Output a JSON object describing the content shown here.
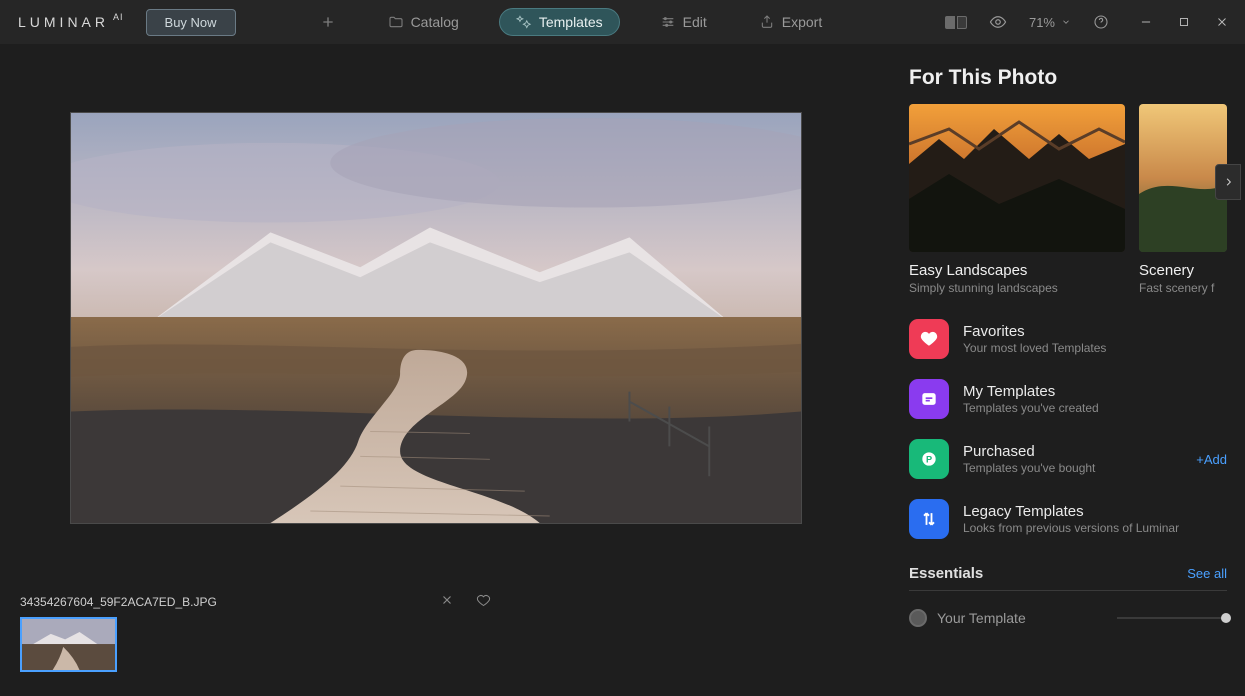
{
  "app": {
    "logo": "LUMINAR",
    "logo_sup": "AI",
    "buy": "Buy Now"
  },
  "nav": {
    "catalog": "Catalog",
    "templates": "Templates",
    "edit": "Edit",
    "export": "Export"
  },
  "toolbar": {
    "zoom": "71%"
  },
  "file": {
    "name": "34354267604_59F2ACA7ED_B.JPG"
  },
  "panel": {
    "title": "For This Photo",
    "collections": [
      {
        "name": "Easy Landscapes",
        "desc": "Simply stunning landscapes"
      },
      {
        "name": "Scenery",
        "desc": "Fast scenery f"
      }
    ],
    "categories": [
      {
        "title": "Favorites",
        "desc": "Your most loved Templates",
        "color": "#ef3b56",
        "icon": "heart"
      },
      {
        "title": "My Templates",
        "desc": "Templates you've created",
        "color": "#8a3bef",
        "icon": "card"
      },
      {
        "title": "Purchased",
        "desc": "Templates you've bought",
        "color": "#18b979",
        "icon": "p",
        "add": "+Add"
      },
      {
        "title": "Legacy Templates",
        "desc": "Looks from previous versions of Luminar",
        "color": "#2a6df0",
        "icon": "arrows"
      }
    ],
    "essentials": {
      "header": "Essentials",
      "see_all": "See all"
    },
    "your_template": "Your Template"
  }
}
